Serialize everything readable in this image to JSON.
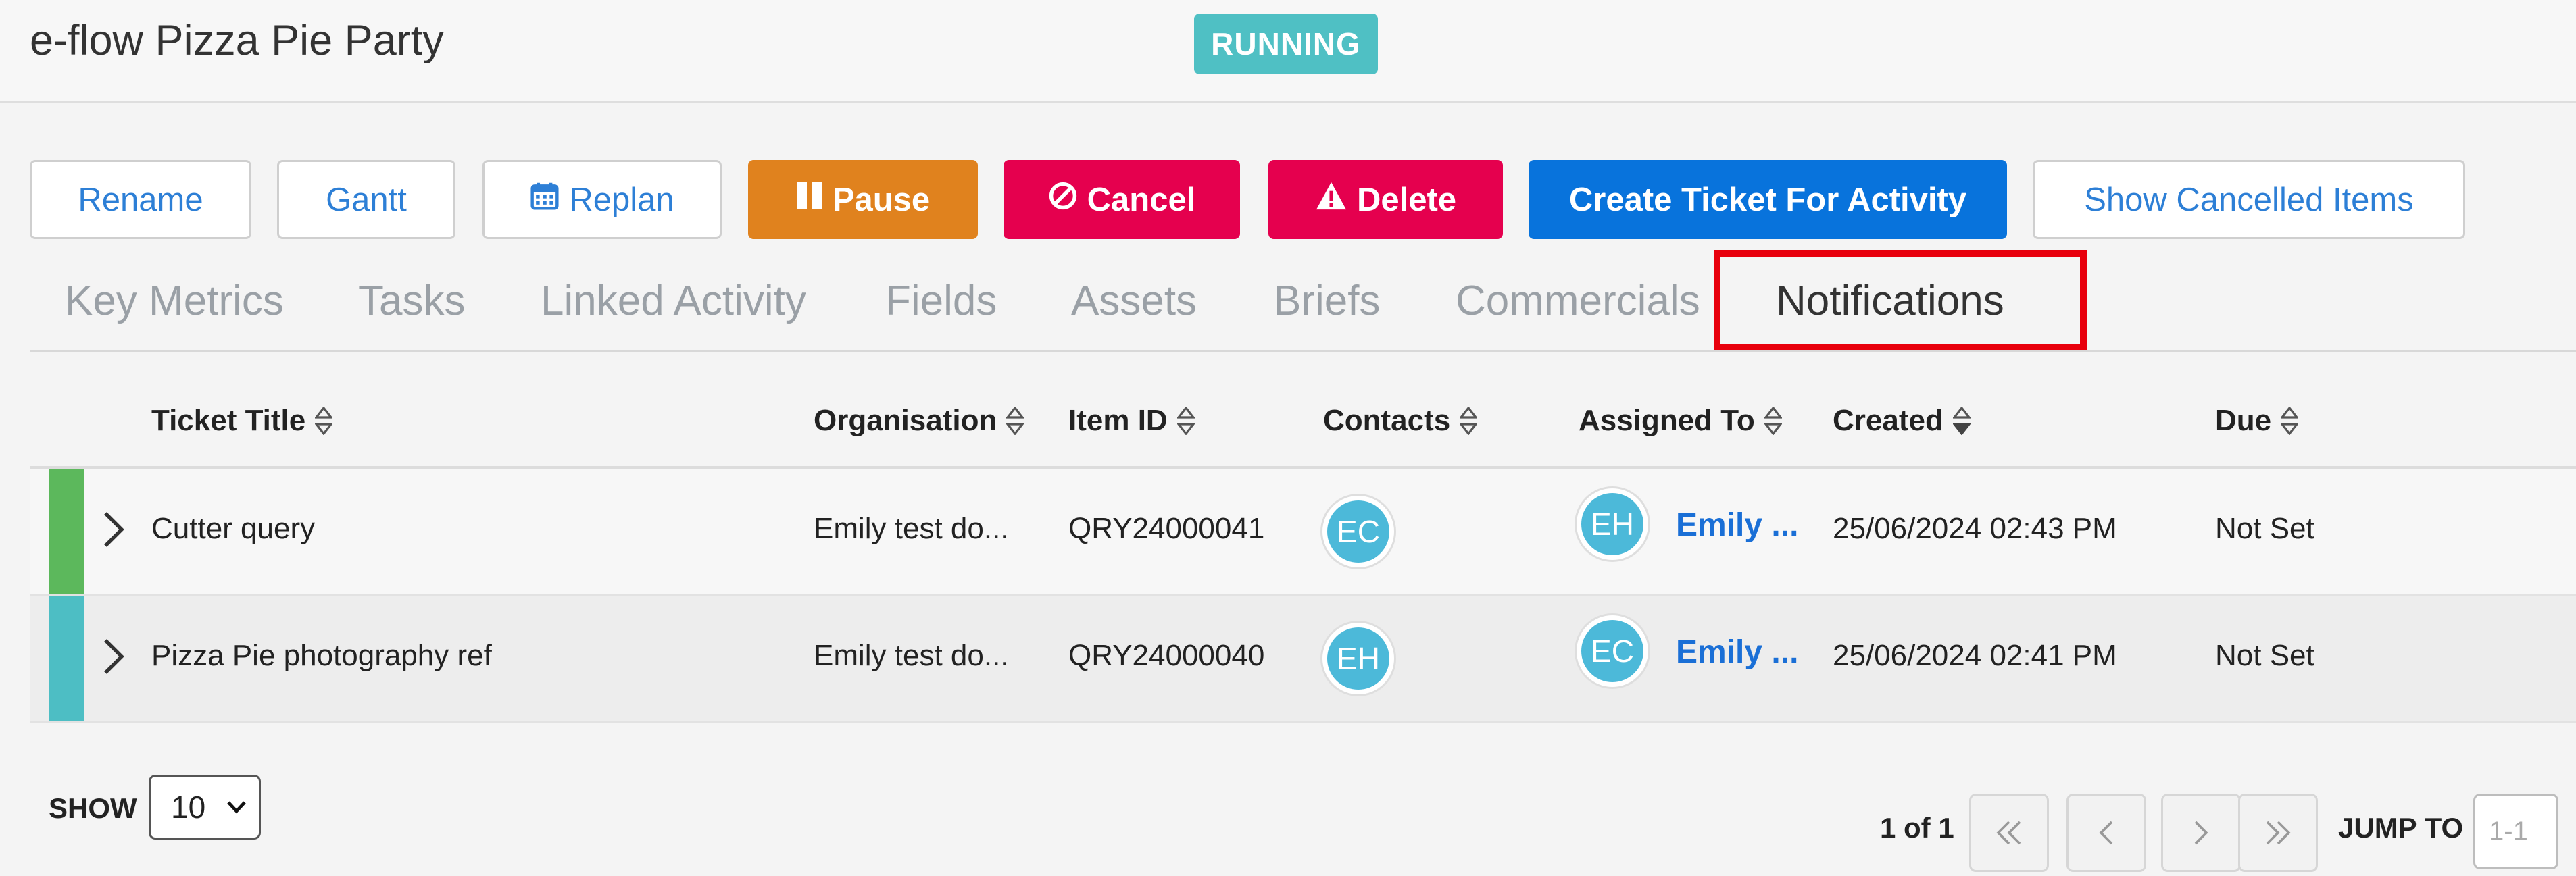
{
  "header": {
    "title": "e-flow Pizza Pie Party",
    "status": "RUNNING"
  },
  "toolbar": {
    "rename": "Rename",
    "gantt": "Gantt",
    "replan": "Replan",
    "pause": "Pause",
    "cancel": "Cancel",
    "delete": "Delete",
    "create_ticket": "Create Ticket For Activity",
    "show_cancelled": "Show Cancelled Items"
  },
  "tabs": [
    {
      "label": "Key Metrics"
    },
    {
      "label": "Tasks"
    },
    {
      "label": "Linked Activity"
    },
    {
      "label": "Fields"
    },
    {
      "label": "Assets"
    },
    {
      "label": "Briefs"
    },
    {
      "label": "Commercials"
    },
    {
      "label": "Notifications",
      "active": true
    }
  ],
  "table": {
    "columns": {
      "ticket_title": "Ticket Title",
      "organisation": "Organisation",
      "item_id": "Item ID",
      "contacts": "Contacts",
      "assigned_to": "Assigned To",
      "created": "Created",
      "due": "Due"
    },
    "rows": [
      {
        "color": "#5cb85c",
        "title": "Cutter query",
        "organisation": "Emily test do...",
        "item_id": "QRY24000041",
        "contact_initials": "EC",
        "assignee_initials": "EH",
        "assignee_name": "Emily ...",
        "created": "25/06/2024 02:43 PM",
        "due": "Not Set"
      },
      {
        "color": "#4dbec4",
        "title": "Pizza Pie photography ref",
        "organisation": "Emily test do...",
        "item_id": "QRY24000040",
        "contact_initials": "EH",
        "assignee_initials": "EC",
        "assignee_name": "Emily ...",
        "created": "25/06/2024 02:41 PM",
        "due": "Not Set"
      }
    ]
  },
  "footer": {
    "show_label": "SHOW",
    "page_size": "10",
    "page_info": "1 of 1",
    "jump_label": "JUMP TO",
    "jump_placeholder": "1-1"
  },
  "icons": {
    "replan": "calendar-icon",
    "pause": "pause-icon",
    "cancel": "ban-icon",
    "delete": "warning-icon",
    "sort": "sort-icon",
    "expand": "chevron-right-icon"
  },
  "colors": {
    "status_badge": "#4fc0c4",
    "pause": "#e0821e",
    "danger": "#e5004e",
    "primary": "#0873dc",
    "tab_highlight": "#e8000d"
  }
}
